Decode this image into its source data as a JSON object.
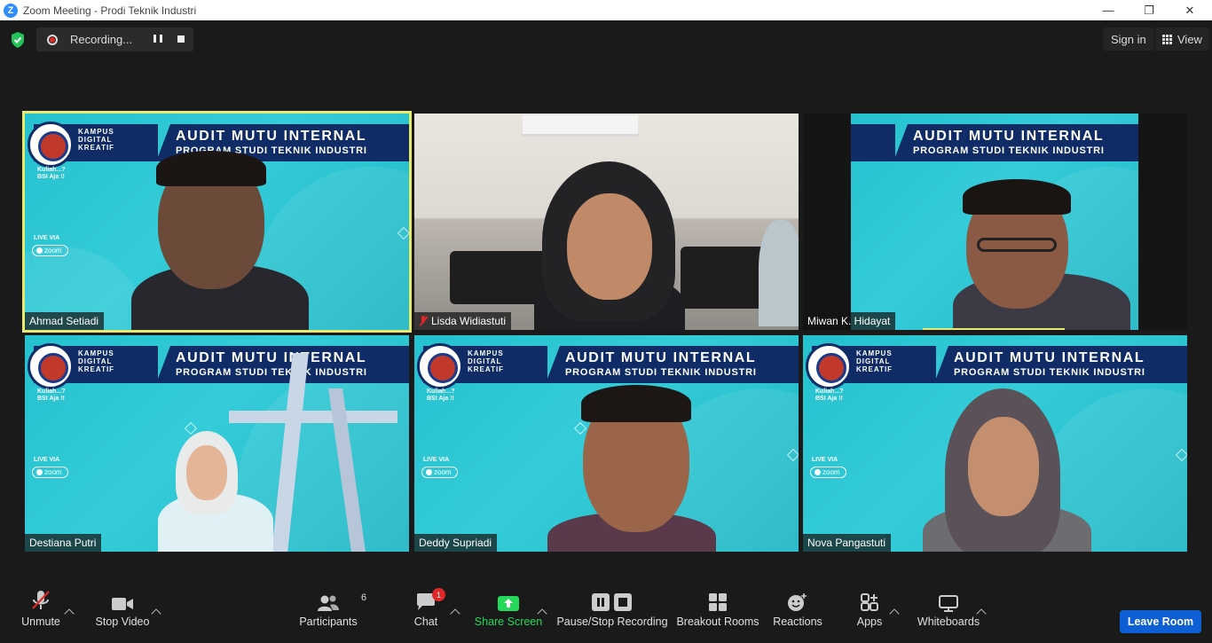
{
  "window": {
    "title": "Zoom Meeting - Prodi Teknik Industri",
    "app_icon_letter": "Z",
    "minimize": "—",
    "restore": "❐",
    "close": "✕"
  },
  "top": {
    "security_icon": "shield-check-icon",
    "recording_label": "Recording...",
    "sign_in": "Sign in",
    "view": "View"
  },
  "banner": {
    "kampus_line1": "KAMPUS",
    "kampus_line2": "DIGITAL",
    "kampus_line3": "KREATIF",
    "title_line1": "AUDIT MUTU INTERNAL",
    "title_line2": "PROGRAM STUDI TEKNIK INDUSTRI",
    "kuliah_line1": "Kuliah...?",
    "kuliah_line2": "BSI Aja !!",
    "live_via": "LIVE VIA",
    "zoom_tag": "zoom"
  },
  "participants": [
    {
      "name": "Ahmad Setiadi",
      "muted": false,
      "speaking": true
    },
    {
      "name": "Lisda Widiastuti",
      "muted": true,
      "speaking": false
    },
    {
      "name": "Miwan K. Hidayat",
      "muted": false,
      "speaking": false
    },
    {
      "name": "Destiana Putri",
      "muted": false,
      "speaking": false
    },
    {
      "name": "Deddy Supriadi",
      "muted": false,
      "speaking": false
    },
    {
      "name": "Nova Pangastuti",
      "muted": false,
      "speaking": false
    }
  ],
  "toolbar": {
    "unmute": "Unmute",
    "stop_video": "Stop Video",
    "participants": "Participants",
    "participants_count": "6",
    "chat": "Chat",
    "chat_badge": "1",
    "share_screen": "Share Screen",
    "pause_stop_recording": "Pause/Stop Recording",
    "breakout_rooms": "Breakout Rooms",
    "reactions": "Reactions",
    "apps": "Apps",
    "whiteboards": "Whiteboards",
    "leave_room": "Leave Room"
  },
  "colors": {
    "accent_blue": "#0e5fd4",
    "share_green": "#23d959",
    "speaking_outline": "#e6ea6a",
    "muted_red": "#e02828"
  }
}
